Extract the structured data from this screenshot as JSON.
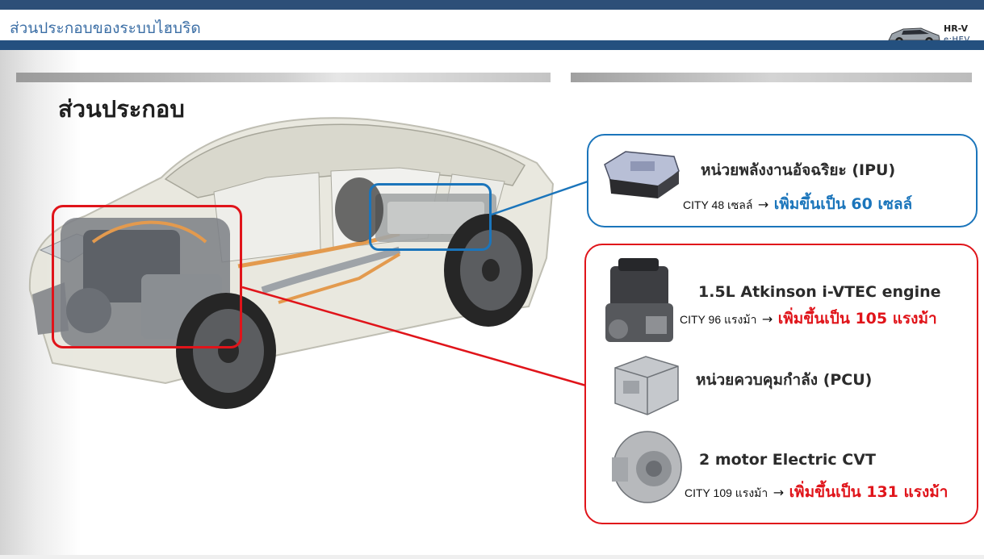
{
  "header": {
    "title": "ส่วนประกอบของระบบไฮบริด",
    "logo_model": "HR-V",
    "logo_sub": "e:HEV"
  },
  "section": {
    "title": "ส่วนประกอบ"
  },
  "ipu": {
    "title": "หน่วยพลังงานอัจฉริยะ (IPU)",
    "old": "CITY 48  เซลล์",
    "arrow": "→",
    "new": "เพิ่มขึ้นเป็น 60 เซลล์"
  },
  "engine": {
    "title": "1.5L Atkinson i-VTEC engine",
    "old": "CITY 96 แรงม้า",
    "arrow": "→",
    "new": "เพิ่มขึ้นเป็น 105 แรงม้า"
  },
  "pcu": {
    "title": "หน่วยควบคุมกำลัง (PCU)"
  },
  "cvt": {
    "title": "2 motor Electric CVT",
    "old": "CITY 109 แรงม้า",
    "arrow": "→",
    "new": "เพิ่มขึ้นเป็น 131 แรงม้า"
  },
  "colors": {
    "header_band": "#2d4f78",
    "title_blue": "#3b6ea5",
    "accent_red": "#e0141a",
    "accent_blue": "#1b75bb"
  }
}
